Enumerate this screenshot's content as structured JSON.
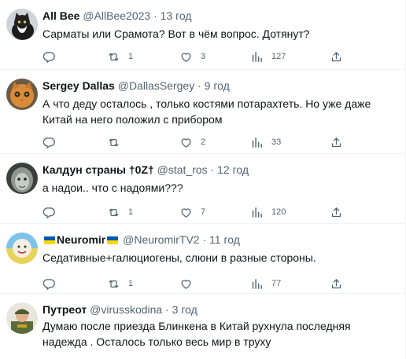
{
  "tweets": [
    {
      "name": "All Bee",
      "handle": "@AllBee2023",
      "sep": "·",
      "time": "13 год",
      "text": "Сарматы или Срамота? Вот в чём вопрос. Дотянут?",
      "replies": "",
      "retweets": "1",
      "likes": "3",
      "views": "127"
    },
    {
      "name": "Sergey Dallas",
      "handle": "@DallasSergey",
      "sep": "·",
      "time": "9 год",
      "text": "А что деду осталось , только костями потарахтеть. Но уже даже Китай на него положил с прибором",
      "replies": "",
      "retweets": "",
      "likes": "2",
      "views": "33"
    },
    {
      "name": "Калдун страны †0Z†",
      "handle": "@stat_ros",
      "sep": "·",
      "time": "12 год",
      "text": "а надои.. что с надоями???",
      "replies": "",
      "retweets": "1",
      "likes": "7",
      "views": "120"
    },
    {
      "name": "Neuromir",
      "handle": "@NeuromirTV2",
      "sep": "·",
      "time": "11 год",
      "text": "Седативные+галюциогены, слюни в разные стороны.",
      "replies": "",
      "retweets": "1",
      "likes": "",
      "views": "77"
    },
    {
      "name": "Путреот",
      "handle": "@virusskodina",
      "sep": "·",
      "time": "3 год",
      "text": "Думаю после приезда Блинкена в Китай рухнула последняя надежда . Осталось только весь мир в труху"
    }
  ],
  "icons": {
    "reply": "reply-icon",
    "retweet": "retweet-icon",
    "like": "heart-icon",
    "views": "views-icon",
    "share": "share-icon"
  },
  "colors": {
    "text": "#0f1419",
    "secondary": "#536471",
    "divider": "#eff3f4",
    "flag_blue": "#0057b7",
    "flag_yellow": "#ffd700"
  }
}
